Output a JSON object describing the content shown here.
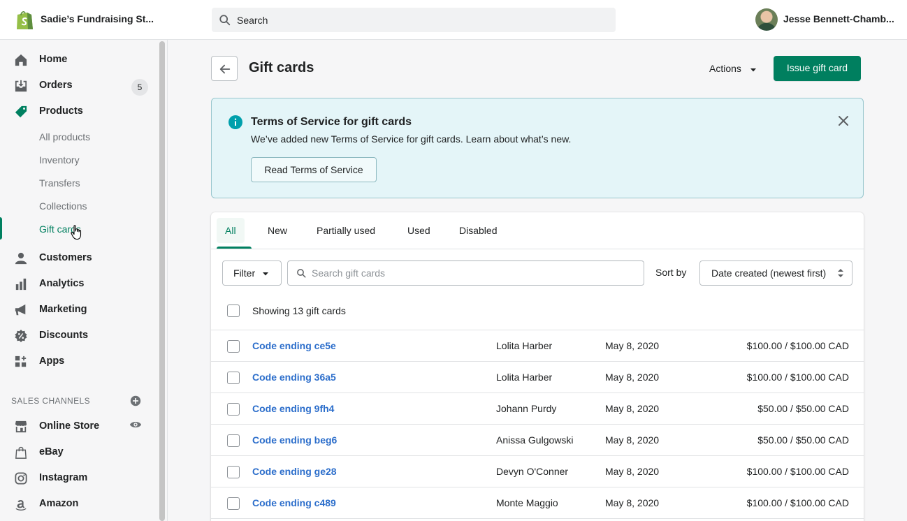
{
  "topbar": {
    "store_name": "Sadie’s Fundraising St...",
    "search_placeholder": "Search",
    "user_name": "Jesse Bennett-Chamb..."
  },
  "sidebar": {
    "items": [
      {
        "label": "Home",
        "icon": "home-icon"
      },
      {
        "label": "Orders",
        "icon": "orders-icon",
        "badge": "5"
      },
      {
        "label": "Products",
        "icon": "tag-icon"
      }
    ],
    "product_subitems": [
      "All products",
      "Inventory",
      "Transfers",
      "Collections",
      "Gift cards"
    ],
    "items_after": [
      {
        "label": "Customers",
        "icon": "person-icon"
      },
      {
        "label": "Analytics",
        "icon": "bar-chart-icon"
      },
      {
        "label": "Marketing",
        "icon": "megaphone-icon"
      },
      {
        "label": "Discounts",
        "icon": "discount-icon"
      },
      {
        "label": "Apps",
        "icon": "apps-icon"
      }
    ],
    "sales_channels_title": "SALES CHANNELS",
    "channels": [
      {
        "label": "Online Store",
        "icon": "store-icon"
      },
      {
        "label": "eBay",
        "icon": "bag-icon"
      },
      {
        "label": "Instagram",
        "icon": "instagram-icon"
      },
      {
        "label": "Amazon",
        "icon": "amazon-icon"
      }
    ]
  },
  "page": {
    "title": "Gift cards",
    "actions_label": "Actions",
    "primary_label": "Issue gift card"
  },
  "banner": {
    "title": "Terms of Service for gift cards",
    "text": "We’ve added new Terms of Service for gift cards. Learn about what’s new.",
    "button_label": "Read Terms of Service"
  },
  "tabs": [
    "All",
    "New",
    "Partially used",
    "Used",
    "Disabled"
  ],
  "filters": {
    "filter_label": "Filter",
    "search_placeholder": "Search gift cards",
    "sort_label": "Sort by",
    "sort_value": "Date created (newest first)"
  },
  "list": {
    "showing_text": "Showing 13 gift cards",
    "rows": [
      {
        "code": "Code ending ce5e",
        "customer": "Lolita Harber",
        "date": "May 8, 2020",
        "balance": "$100.00 / $100.00 CAD"
      },
      {
        "code": "Code ending 36a5",
        "customer": "Lolita Harber",
        "date": "May 8, 2020",
        "balance": "$100.00 / $100.00 CAD"
      },
      {
        "code": "Code ending 9fh4",
        "customer": "Johann Purdy",
        "date": "May 8, 2020",
        "balance": "$50.00 / $50.00 CAD"
      },
      {
        "code": "Code ending beg6",
        "customer": "Anissa Gulgowski",
        "date": "May 8, 2020",
        "balance": "$50.00 / $50.00 CAD"
      },
      {
        "code": "Code ending ge28",
        "customer": "Devyn O'Conner",
        "date": "May 8, 2020",
        "balance": "$100.00 / $100.00 CAD"
      },
      {
        "code": "Code ending c489",
        "customer": "Monte Maggio",
        "date": "May 8, 2020",
        "balance": "$100.00 / $100.00 CAD"
      }
    ]
  },
  "colors": {
    "brand_green": "#007f5f",
    "link_blue": "#2c6ecb",
    "banner_bg": "#e4f5f8"
  }
}
